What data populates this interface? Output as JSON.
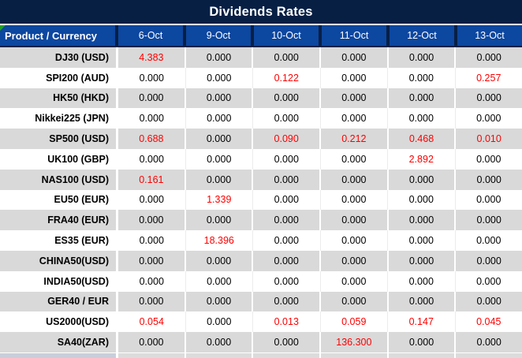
{
  "window": {
    "title": "Dividends Rates"
  },
  "table": {
    "corner_header": "Product / Currency",
    "date_headers": [
      "6-Oct",
      "9-Oct",
      "10-Oct",
      "11-Oct",
      "12-Oct",
      "13-Oct"
    ],
    "zero_value": "0.000",
    "rows": [
      {
        "product": "DJ30 (USD)",
        "values": [
          "4.383",
          "0.000",
          "0.000",
          "0.000",
          "0.000",
          "0.000"
        ]
      },
      {
        "product": "SPI200 (AUD)",
        "values": [
          "0.000",
          "0.000",
          "0.122",
          "0.000",
          "0.000",
          "0.257"
        ]
      },
      {
        "product": "HK50 (HKD)",
        "values": [
          "0.000",
          "0.000",
          "0.000",
          "0.000",
          "0.000",
          "0.000"
        ]
      },
      {
        "product": "Nikkei225 (JPN)",
        "values": [
          "0.000",
          "0.000",
          "0.000",
          "0.000",
          "0.000",
          "0.000"
        ]
      },
      {
        "product": "SP500 (USD)",
        "values": [
          "0.688",
          "0.000",
          "0.090",
          "0.212",
          "0.468",
          "0.010"
        ]
      },
      {
        "product": "UK100 (GBP)",
        "values": [
          "0.000",
          "0.000",
          "0.000",
          "0.000",
          "2.892",
          "0.000"
        ]
      },
      {
        "product": "NAS100 (USD)",
        "values": [
          "0.161",
          "0.000",
          "0.000",
          "0.000",
          "0.000",
          "0.000"
        ]
      },
      {
        "product": "EU50 (EUR)",
        "values": [
          "0.000",
          "1.339",
          "0.000",
          "0.000",
          "0.000",
          "0.000"
        ]
      },
      {
        "product": "FRA40 (EUR)",
        "values": [
          "0.000",
          "0.000",
          "0.000",
          "0.000",
          "0.000",
          "0.000"
        ]
      },
      {
        "product": "ES35 (EUR)",
        "values": [
          "0.000",
          "18.396",
          "0.000",
          "0.000",
          "0.000",
          "0.000"
        ]
      },
      {
        "product": "CHINA50(USD)",
        "values": [
          "0.000",
          "0.000",
          "0.000",
          "0.000",
          "0.000",
          "0.000"
        ]
      },
      {
        "product": "INDIA50(USD)",
        "values": [
          "0.000",
          "0.000",
          "0.000",
          "0.000",
          "0.000",
          "0.000"
        ]
      },
      {
        "product": "GER40 / EUR",
        "values": [
          "0.000",
          "0.000",
          "0.000",
          "0.000",
          "0.000",
          "0.000"
        ]
      },
      {
        "product": "US2000(USD)",
        "values": [
          "0.054",
          "0.000",
          "0.013",
          "0.059",
          "0.147",
          "0.045"
        ]
      },
      {
        "product": "SA40(ZAR)",
        "values": [
          "0.000",
          "0.000",
          "0.000",
          "136.300",
          "0.000",
          "0.000"
        ]
      }
    ]
  },
  "icons": {
    "error_marker": "excel-green-corner-triangle"
  },
  "colors": {
    "title_bar_bg": "#081f44",
    "header_bg": "#0c47a0",
    "header_text": "#ffffff",
    "row_alt_bg": "#d9d9d9",
    "row_bg": "#ffffff",
    "value_color": "#000000",
    "nonzero_value_color": "#fe0000",
    "error_marker_green": "#21a121",
    "partial_row_first_col_bg": "#c9cedb",
    "partial_row_bg": "#dcdcdc"
  }
}
